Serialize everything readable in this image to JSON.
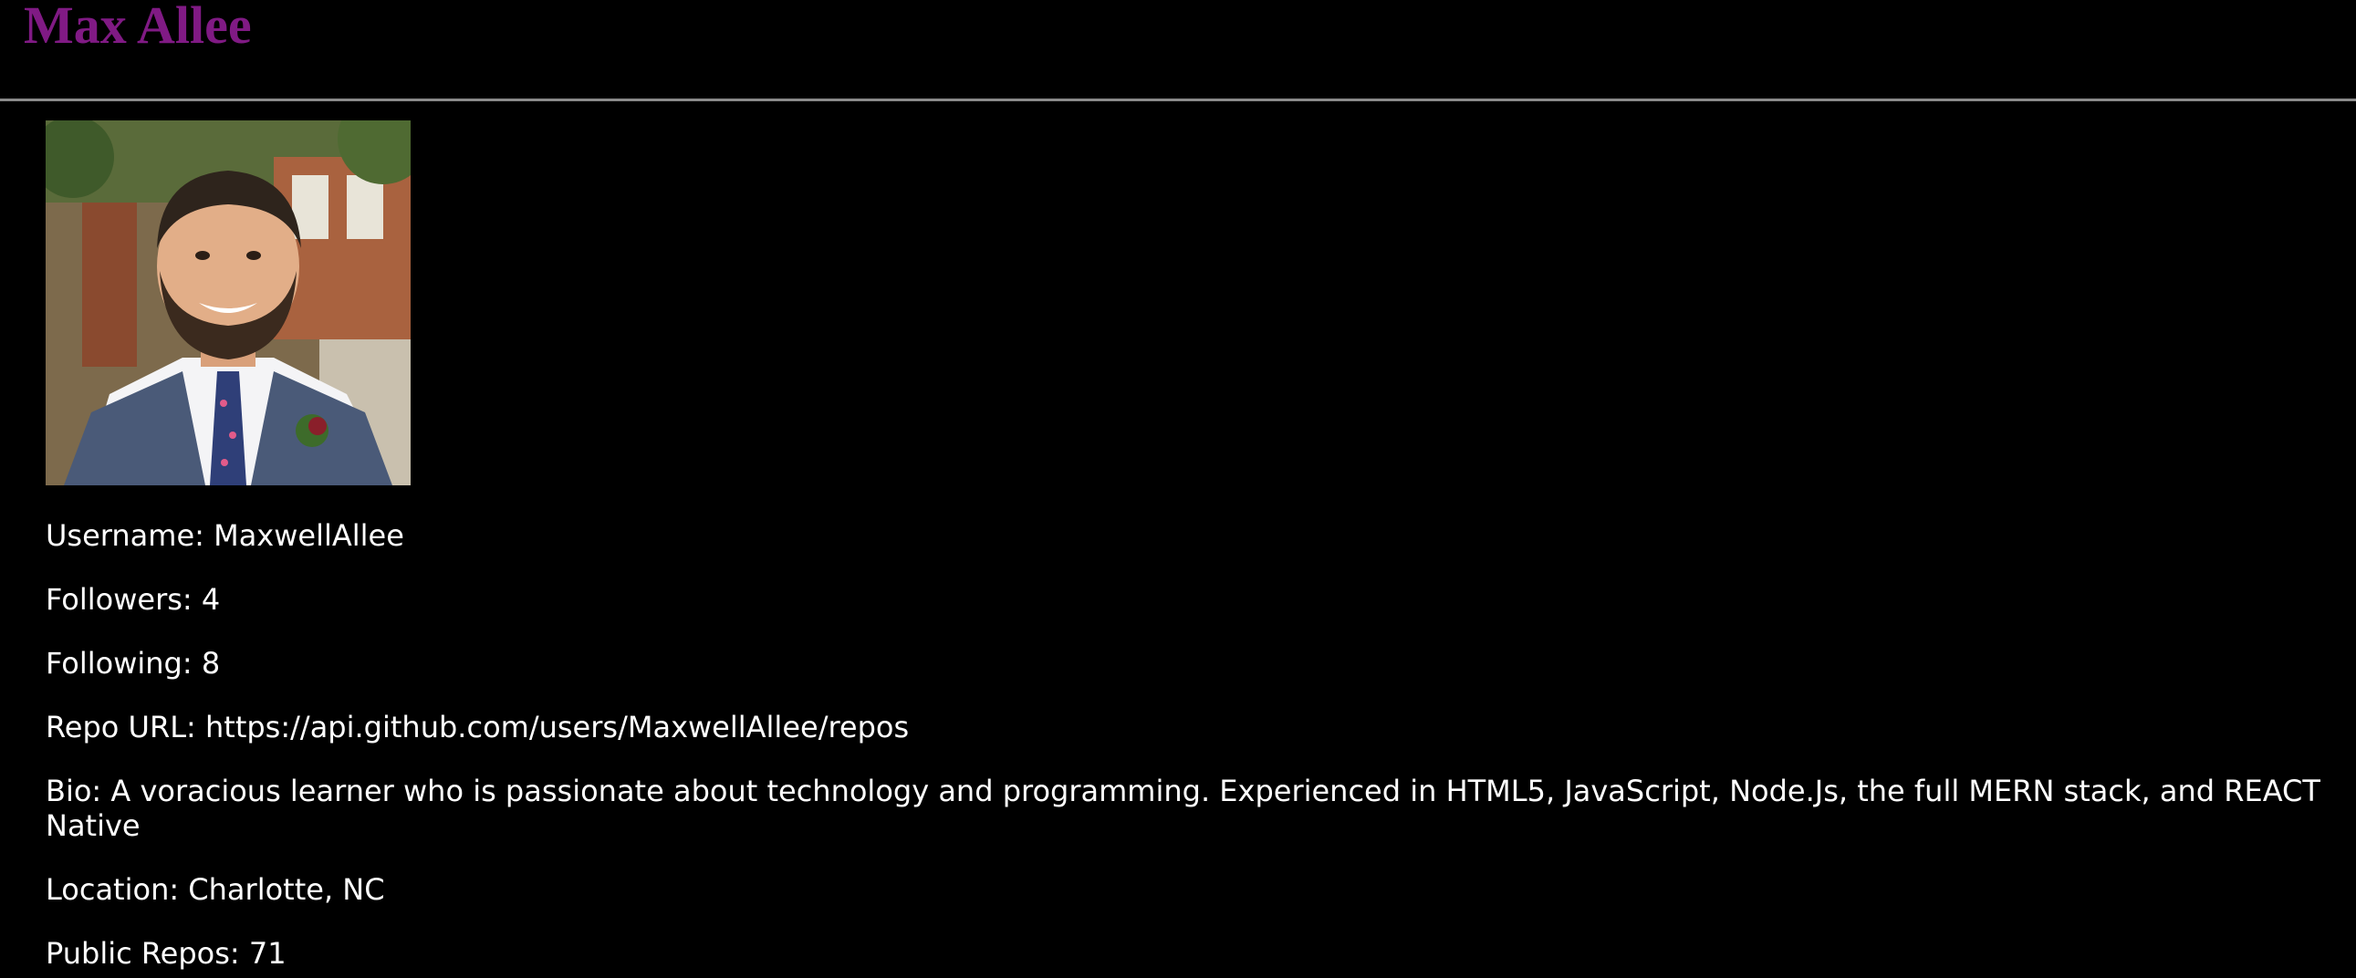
{
  "profile": {
    "name": "Max Allee",
    "username": "Username: MaxwellAllee",
    "followers": "Followers: 4",
    "following": "Following: 8",
    "repo_url": "Repo URL: https://api.github.com/users/MaxwellAllee/repos",
    "bio": "Bio: A voracious learner who is passionate about technology and programming. Experienced in HTML5, JavaScript, Node.Js, the full MERN stack, and REACT Native",
    "location": "Location: Charlotte, NC",
    "public_repos": "Public Repos: 71"
  },
  "colors": {
    "background": "#000000",
    "title": "#801a84",
    "text": "#ffffff",
    "divider": "#8a8a8a"
  }
}
